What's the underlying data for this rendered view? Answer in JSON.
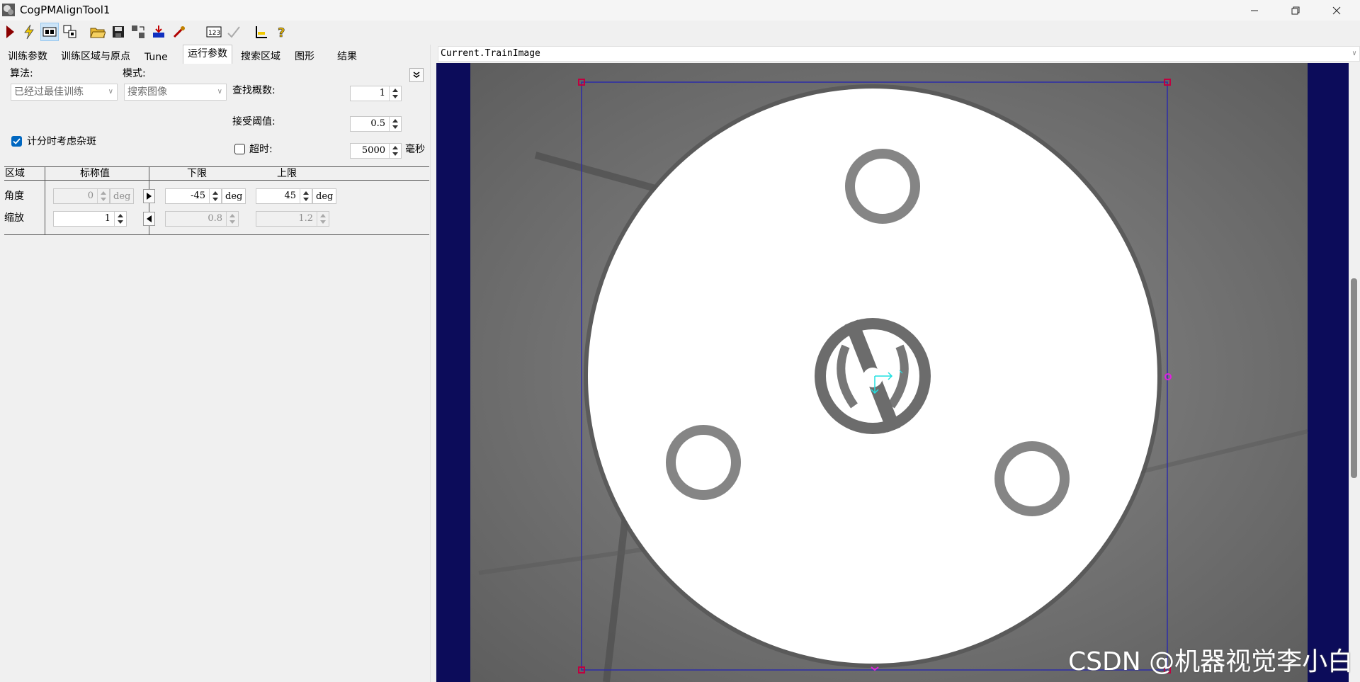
{
  "window": {
    "title": "CogPMAlignTool1"
  },
  "toolbar": {
    "icons": [
      "run-icon",
      "electric-icon",
      "show-train-image-icon",
      "copy-icons-icon",
      "open-icon",
      "save-icon",
      "reset-icon",
      "import-icon",
      "wand-icon",
      "counter-icon",
      "check-icon",
      "ruler-icon",
      "help-icon"
    ]
  },
  "tabs": [
    "训练参数",
    "训练区域与原点",
    "Tune",
    "运行参数",
    "搜索区域",
    "图形",
    "结果"
  ],
  "selected_tab": "运行参数",
  "run_params": {
    "algorithm_label": "算法:",
    "algorithm_value": "已经过最佳训练",
    "mode_label": "模式:",
    "mode_value": "搜索图像",
    "find_count_label": "查找概数:",
    "find_count_value": "1",
    "accept_threshold_label": "接受阈值:",
    "accept_threshold_value": "0.5",
    "timeout_label": "超时:",
    "timeout_value": "5000",
    "timeout_unit": "毫秒",
    "timeout_checked": false,
    "clutter_label": "计分时考虑杂斑",
    "clutter_checked": true
  },
  "dof_table": {
    "headers": [
      "区域",
      "标称值",
      "下限",
      "上限"
    ],
    "rows": [
      {
        "name": "角度",
        "nominal": "0",
        "nominal_unit": "deg",
        "low": "-45",
        "low_unit": "deg",
        "high": "45",
        "high_unit": "deg"
      },
      {
        "name": "缩放",
        "nominal": "1",
        "low": "0.8",
        "high": "1.2"
      }
    ]
  },
  "image_panel": {
    "header": "Current.TrainImage"
  },
  "watermark": "CSDN @机器视觉李小白",
  "colors": {
    "viewer_bg": "#0c0c5a",
    "roi": "#2c2ca8",
    "handle": "#c00040",
    "axis": "#20e0e0",
    "accent": "#0067c0"
  }
}
